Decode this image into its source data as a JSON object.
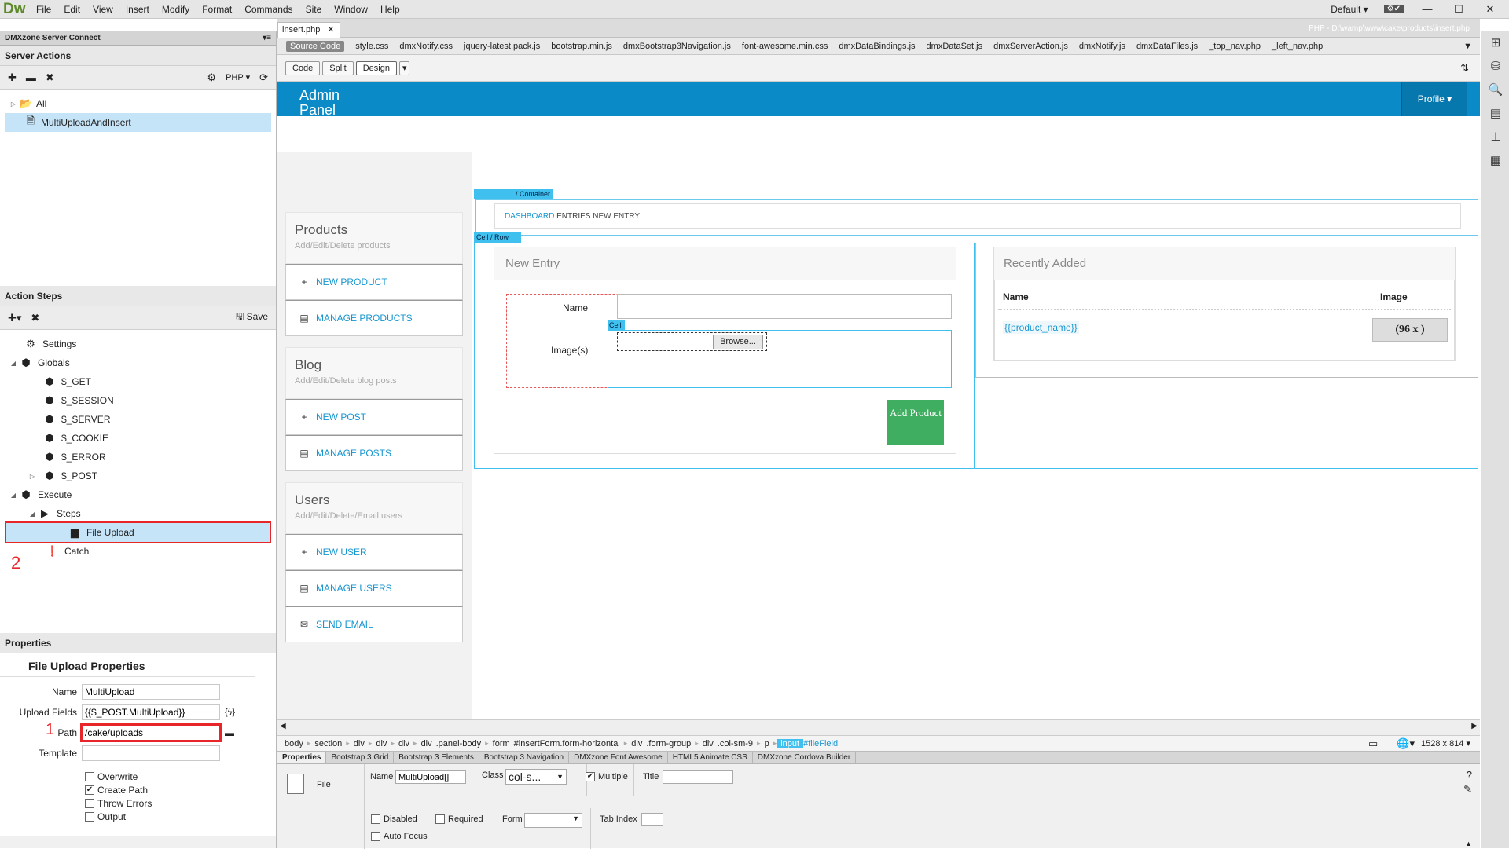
{
  "app": {
    "logo": "Dw",
    "workspace": "Default",
    "min": "—",
    "max": "☐",
    "close": "✕"
  },
  "menu": [
    "File",
    "Edit",
    "View",
    "Insert",
    "Modify",
    "Format",
    "Commands",
    "Site",
    "Window",
    "Help"
  ],
  "server_panel": {
    "tab": "DMXzone Server Connect",
    "title": "Server Actions",
    "lang": "PHP",
    "items": [
      {
        "label": "All"
      },
      {
        "label": "MultiUploadAndInsert"
      }
    ]
  },
  "action_steps": {
    "title": "Action Steps",
    "save": "Save",
    "tree": [
      "Settings",
      "Globals",
      "$_GET",
      "$_SESSION",
      "$_SERVER",
      "$_COOKIE",
      "$_ERROR",
      "$_POST",
      "Execute",
      "Steps",
      "File Upload",
      "Catch"
    ],
    "annot2": "2"
  },
  "properties": {
    "title": "Properties",
    "subtitle": "File Upload Properties",
    "fields": [
      {
        "label": "Name",
        "value": "MultiUpload"
      },
      {
        "label": "Upload Fields",
        "value": "{{$_POST.MultiUpload}}"
      },
      {
        "label": "Path",
        "value": "/cake/uploads"
      },
      {
        "label": "Template",
        "value": ""
      }
    ],
    "annot1": "1",
    "checks": [
      {
        "label": "Overwrite",
        "checked": false
      },
      {
        "label": "Create Path",
        "checked": true
      },
      {
        "label": "Throw Errors",
        "checked": false
      },
      {
        "label": "Output",
        "checked": false
      }
    ]
  },
  "document": {
    "file_tab": "insert.php",
    "path": "PHP - D:\\wamp\\www\\cake\\products\\insert.php",
    "related": [
      "Source Code",
      "style.css",
      "dmxNotify.css",
      "jquery-latest.pack.js",
      "bootstrap.min.js",
      "dmxBootstrap3Navigation.js",
      "font-awesome.min.css",
      "dmxDataBindings.js",
      "dmxDataSet.js",
      "dmxServerAction.js",
      "dmxNotify.js",
      "dmxDataFiles.js",
      "_top_nav.php",
      "_left_nav.php"
    ],
    "views": [
      "Code",
      "Split",
      "Design"
    ]
  },
  "page": {
    "admin": "Admin Panel",
    "profile": "Profile",
    "sidebar": [
      {
        "title": "Products",
        "sub": "Add/Edit/Delete products",
        "buttons": [
          {
            "icon": "+",
            "label": "NEW PRODUCT"
          },
          {
            "icon": "▤",
            "label": "MANAGE PRODUCTS"
          }
        ]
      },
      {
        "title": "Blog",
        "sub": "Add/Edit/Delete blog posts",
        "buttons": [
          {
            "icon": "+",
            "label": "NEW POST"
          },
          {
            "icon": "▤",
            "label": "MANAGE POSTS"
          }
        ]
      },
      {
        "title": "Users",
        "sub": "Add/Edit/Delete/Email users",
        "buttons": [
          {
            "icon": "+",
            "label": "NEW USER"
          },
          {
            "icon": "▤",
            "label": "MANAGE USERS"
          },
          {
            "icon": "✉",
            "label": "SEND EMAIL"
          }
        ]
      }
    ],
    "container_label": "/ Container",
    "cellrow_label": "Cell / Row",
    "cell_label": "Cell",
    "breadcrumb": {
      "link": "DASHBOARD",
      "rest": "ENTRIES NEW ENTRY"
    },
    "new_entry": {
      "title": "New Entry",
      "name_label": "Name",
      "images_label": "Image(s)",
      "browse": "Browse...",
      "add": "Add Product"
    },
    "recent": {
      "title": "Recently Added",
      "col_name": "Name",
      "col_image": "Image",
      "cell_name": "{{product_name}}",
      "cell_image": "(96 x )"
    }
  },
  "tagbar": [
    "body",
    "section",
    "div",
    "div",
    "div",
    "div",
    ".panel-body",
    "form",
    "#insertForm.form-horizontal",
    "div",
    ".form-group",
    "div",
    ".col-sm-9",
    "p",
    "input",
    "#fileField"
  ],
  "status": {
    "size": "1528 x 814"
  },
  "prop_inspector": {
    "tabs": [
      "Properties",
      "Bootstrap 3 Grid",
      "Bootstrap 3 Elements",
      "Bootstrap 3 Navigation",
      "DMXzone Font Awesome",
      "HTML5 Animate CSS",
      "DMXzone Cordova Builder"
    ],
    "file_label": "File",
    "name_label": "Name",
    "name_value": "MultiUpload[]",
    "class_label": "Class",
    "class_value": "col-s...",
    "multiple": "Multiple",
    "title_label": "Title",
    "disabled": "Disabled",
    "required": "Required",
    "form_label": "Form",
    "tabindex_label": "Tab Index",
    "autofocus": "Auto Focus"
  }
}
